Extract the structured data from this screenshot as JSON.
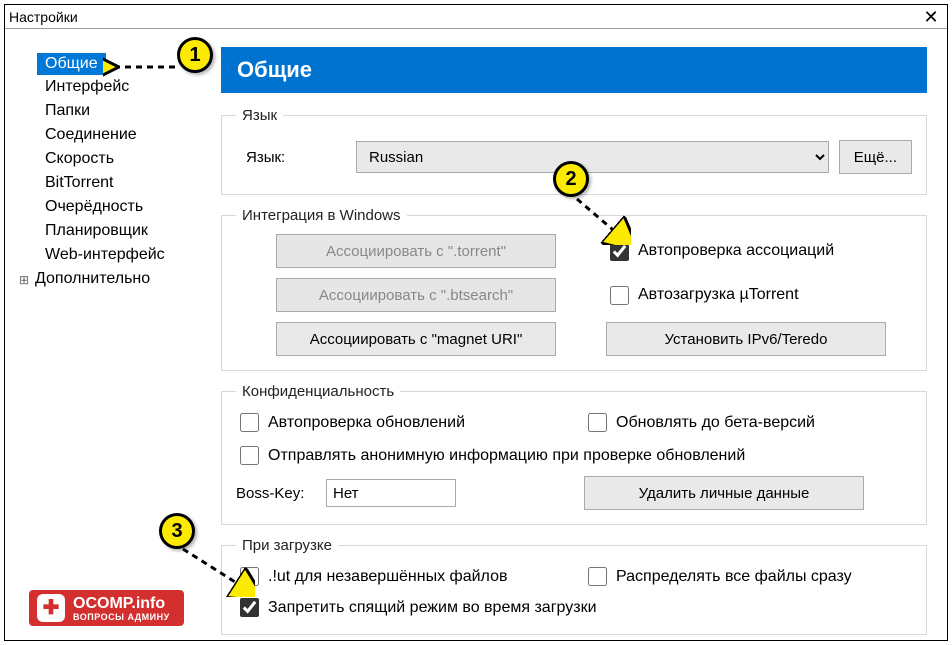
{
  "window": {
    "title": "Настройки"
  },
  "sidebar": {
    "items": [
      {
        "label": "Общие",
        "selected": true
      },
      {
        "label": "Интерфейс"
      },
      {
        "label": "Папки"
      },
      {
        "label": "Соединение"
      },
      {
        "label": "Скорость"
      },
      {
        "label": "BitTorrent"
      },
      {
        "label": "Очерёдность"
      },
      {
        "label": "Планировщик"
      },
      {
        "label": "Web-интерфейс"
      },
      {
        "label": "Дополнительно",
        "expandable": true
      }
    ]
  },
  "header": {
    "title": "Общие"
  },
  "language": {
    "legend": "Язык",
    "label": "Язык:",
    "selected": "Russian",
    "more_btn": "Ещё..."
  },
  "integration": {
    "legend": "Интеграция в Windows",
    "assoc_torrent": "Ассоциировать с \".torrent\"",
    "assoc_btsearch": "Ассоциировать с \".btsearch\"",
    "assoc_magnet": "Ассоциировать с \"magnet URI\"",
    "auto_check_label": "Автопроверка ассоциаций",
    "auto_check_checked": true,
    "autoload_label": "Автозагрузка µTorrent",
    "autoload_checked": false,
    "ipv6_btn": "Установить IPv6/Teredo"
  },
  "privacy": {
    "legend": "Конфиденциальность",
    "auto_update_label": "Автопроверка обновлений",
    "auto_update_checked": false,
    "beta_label": "Обновлять до бета-версий",
    "beta_checked": false,
    "anon_label": "Отправлять анонимную информацию при проверке обновлений",
    "anon_checked": false,
    "bosskey_label": "Boss-Key:",
    "bosskey_value": "Нет",
    "delete_btn": "Удалить личные данные"
  },
  "onload": {
    "legend": "При загрузке",
    "ut_label": ".!ut для незавершённых файлов",
    "ut_checked": false,
    "spread_label": "Распределять все файлы сразу",
    "spread_checked": false,
    "sleep_label": "Запретить спящий режим во время загрузки",
    "sleep_checked": true
  },
  "annotations": {
    "marker1": "1",
    "marker2": "2",
    "marker3": "3"
  },
  "watermark": {
    "main": "OCOMP.info",
    "sub": "ВОПРОСЫ АДМИНУ"
  }
}
